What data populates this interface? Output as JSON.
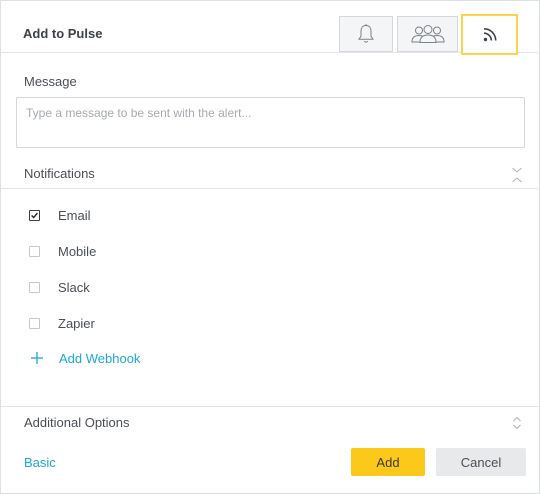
{
  "header": {
    "title": "Add to Pulse",
    "tabs": [
      {
        "icon": "bell-icon"
      },
      {
        "icon": "group-icon"
      },
      {
        "icon": "rss-icon",
        "selected": true
      }
    ]
  },
  "message": {
    "label": "Message",
    "placeholder": "Type a message to be sent with the alert...",
    "value": ""
  },
  "notifications": {
    "label": "Notifications",
    "items": [
      {
        "label": "Email",
        "checked": true
      },
      {
        "label": "Mobile",
        "checked": false
      },
      {
        "label": "Slack",
        "checked": false
      },
      {
        "label": "Zapier",
        "checked": false
      }
    ],
    "add_webhook": "Add Webhook"
  },
  "options": {
    "label": "Additional Options"
  },
  "footer": {
    "basic_label": "Basic",
    "add_label": "Add",
    "cancel_label": "Cancel"
  },
  "colors": {
    "accent_yellow": "#fcc81a",
    "selected_tab_border": "#fbd44c",
    "link_blue": "#1ba8d8"
  }
}
